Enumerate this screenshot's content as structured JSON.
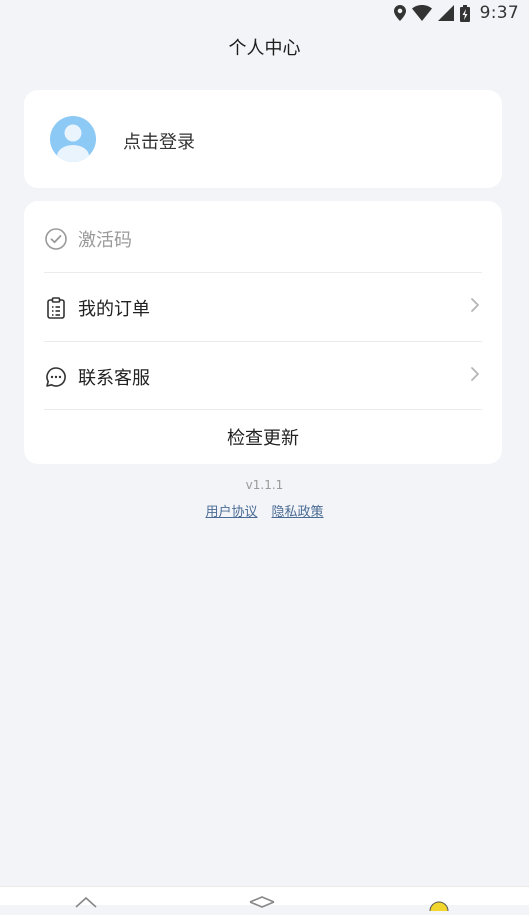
{
  "status_bar": {
    "time": "9:37",
    "icons": [
      "location-icon",
      "wifi-icon",
      "signal-icon",
      "battery-charging-icon"
    ]
  },
  "header": {
    "title": "个人中心"
  },
  "login_card": {
    "avatar_icon": "user-avatar-icon",
    "label": "点击登录"
  },
  "menu": {
    "activation_code": {
      "label": "激活码",
      "icon": "check-circle-icon"
    },
    "my_orders": {
      "label": "我的订单",
      "icon": "clipboard-list-icon"
    },
    "customer_service": {
      "label": "联系客服",
      "icon": "chat-bubble-icon"
    },
    "check_update": {
      "label": "检查更新"
    }
  },
  "footer": {
    "version": "v1.1.1",
    "user_agreement": "用户协议",
    "privacy_policy": "隐私政策"
  },
  "bottom_nav": {
    "icons": [
      "home-icon",
      "box-icon",
      "profile-icon"
    ]
  },
  "colors": {
    "background": "#f3f4f8",
    "card": "#ffffff",
    "avatar": "#8cc9f5",
    "link": "#4a6b95",
    "muted_text": "#9a9a9a",
    "active_tab": "#f2d62e"
  }
}
